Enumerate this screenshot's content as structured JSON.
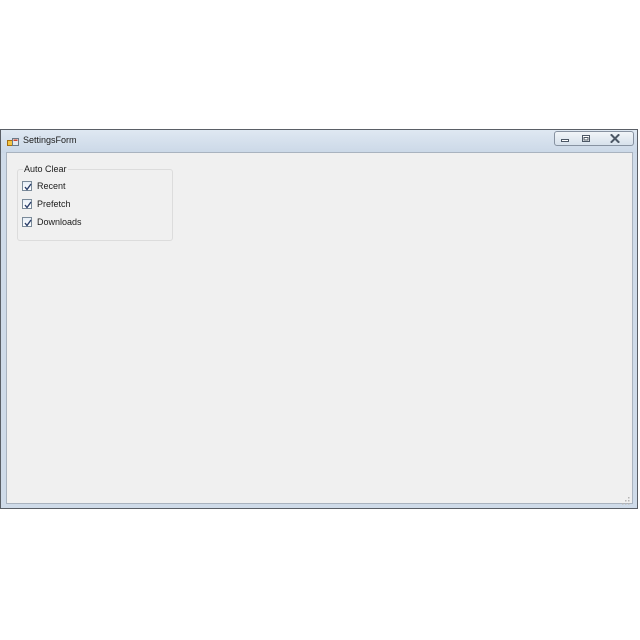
{
  "window": {
    "title": "SettingsForm"
  },
  "title_controls": {
    "minimize_icon": "minimize-icon",
    "maximize_icon": "maximize-icon",
    "close_icon": "close-icon"
  },
  "auto_clear": {
    "legend": "Auto Clear",
    "options": [
      {
        "label": "Recent",
        "checked": true
      },
      {
        "label": "Prefetch",
        "checked": true
      },
      {
        "label": "Downloads",
        "checked": true
      }
    ]
  },
  "colors": {
    "titlebar": "#cbd8e7",
    "client_background": "#f0f0f0",
    "check_mark": "#2b3f6b"
  }
}
